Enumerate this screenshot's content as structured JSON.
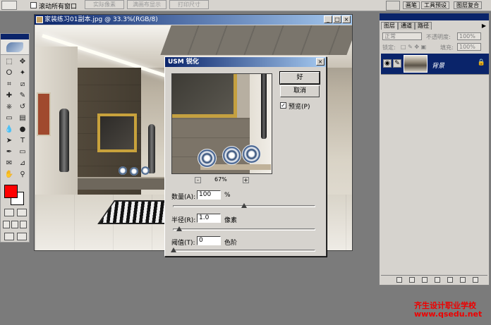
{
  "options_bar": {
    "scroll_all_label": "滚动所有窗口",
    "actual_pixels": "实际像素",
    "fit_screen": "满画布显示",
    "print_size": "打印尺寸"
  },
  "palette_well": {
    "brushes": "画笔",
    "tool_presets": "工具预设",
    "layer_comps": "图层复合"
  },
  "document": {
    "title": "家装练习01副本.jpg @ 33.3%(RGB/8)"
  },
  "dialog": {
    "title": "USM 锐化",
    "ok": "好",
    "cancel": "取消",
    "preview_label": "预览(P)",
    "preview_checked": true,
    "zoom": "67%",
    "amount_label": "数量(A):",
    "amount_value": "100",
    "amount_unit": "%",
    "amount_fraction": 0.5,
    "radius_label": "半径(R):",
    "radius_value": "1.0",
    "radius_unit": "像素",
    "radius_fraction": 0.04,
    "threshold_label": "阈值(T):",
    "threshold_value": "0",
    "threshold_unit": "色阶",
    "threshold_fraction": 0.0
  },
  "layers_panel": {
    "tabs": [
      "图层",
      "通道",
      "路径"
    ],
    "blend_mode": "正常",
    "opacity_label": "不透明度:",
    "opacity_value": "100%",
    "lock_label": "锁定:",
    "fill_label": "填充:",
    "fill_value": "100%",
    "layer_name": "背景"
  },
  "tools": {
    "foreground_color": "#ff0000",
    "background_color": "#ffffff",
    "icons": [
      "marquee-icon",
      "move-icon",
      "lasso-icon",
      "magic-wand-icon",
      "crop-icon",
      "slice-icon",
      "healing-icon",
      "brush-icon",
      "stamp-icon",
      "history-brush-icon",
      "eraser-icon",
      "gradient-icon",
      "blur-icon",
      "dodge-icon",
      "path-select-icon",
      "type-icon",
      "pen-icon",
      "shape-icon",
      "notes-icon",
      "eyedropper-icon",
      "hand-icon",
      "zoom-icon"
    ]
  },
  "watermark": {
    "line1": "齐生设计职业学校",
    "line2": "www.qsedu.net"
  }
}
